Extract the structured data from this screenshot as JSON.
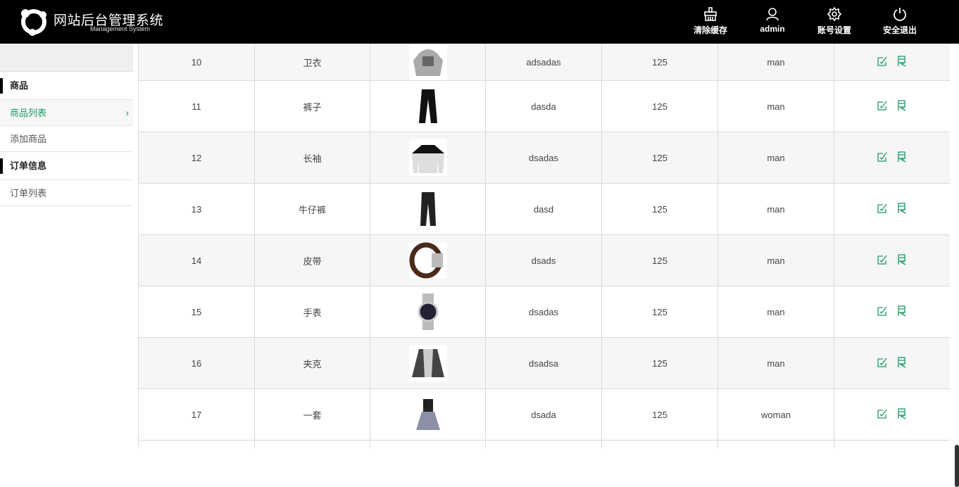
{
  "header": {
    "title": "网站后台管理系统",
    "subtitle": "Management System",
    "actions": [
      {
        "label": "清除缓存",
        "icon": "broom-icon"
      },
      {
        "label": "admin",
        "icon": "user-icon"
      },
      {
        "label": "账号设置",
        "icon": "gear-icon"
      },
      {
        "label": "安全退出",
        "icon": "power-icon"
      }
    ]
  },
  "sidebar": {
    "groups": [
      {
        "label": "商品",
        "items": [
          {
            "label": "商品列表",
            "active": true
          },
          {
            "label": "添加商品",
            "active": false
          }
        ]
      },
      {
        "label": "订单信息",
        "items": [
          {
            "label": "订单列表",
            "active": false
          }
        ]
      }
    ]
  },
  "table": {
    "rows": [
      {
        "id": "10",
        "name": "卫衣",
        "image": "hoodie",
        "desc": "adsadas",
        "price": "125",
        "category": "man"
      },
      {
        "id": "11",
        "name": "裤子",
        "image": "pants",
        "desc": "dasda",
        "price": "125",
        "category": "man"
      },
      {
        "id": "12",
        "name": "长袖",
        "image": "long-sleeve",
        "desc": "dsadas",
        "price": "125",
        "category": "man"
      },
      {
        "id": "13",
        "name": "牛仔裤",
        "image": "jeans",
        "desc": "dasd",
        "price": "125",
        "category": "man"
      },
      {
        "id": "14",
        "name": "皮带",
        "image": "belt",
        "desc": "dsads",
        "price": "125",
        "category": "man"
      },
      {
        "id": "15",
        "name": "手表",
        "image": "watch",
        "desc": "dsadas",
        "price": "125",
        "category": "man"
      },
      {
        "id": "16",
        "name": "夹克",
        "image": "jacket",
        "desc": "dsadsa",
        "price": "125",
        "category": "man"
      },
      {
        "id": "17",
        "name": "一套",
        "image": "dress",
        "desc": "dsada",
        "price": "125",
        "category": "woman"
      }
    ]
  },
  "colors": {
    "accent": "#1a9a63",
    "header_bg": "#000000"
  }
}
